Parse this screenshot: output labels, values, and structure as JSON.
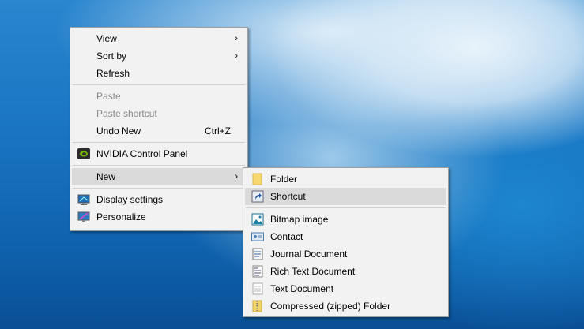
{
  "context_menu": {
    "items": [
      {
        "label": "View",
        "submenu": true
      },
      {
        "label": "Sort by",
        "submenu": true
      },
      {
        "label": "Refresh"
      },
      {
        "label": "Paste",
        "disabled": true
      },
      {
        "label": "Paste shortcut",
        "disabled": true
      },
      {
        "label": "Undo New",
        "shortcut": "Ctrl+Z"
      },
      {
        "label": "NVIDIA Control Panel",
        "icon": "nvidia-icon"
      },
      {
        "label": "New",
        "submenu": true,
        "highlighted": true
      },
      {
        "label": "Display settings",
        "icon": "display-icon"
      },
      {
        "label": "Personalize",
        "icon": "personalize-icon"
      }
    ],
    "arrow": "›"
  },
  "new_submenu": {
    "items": [
      {
        "label": "Folder",
        "icon": "folder-icon"
      },
      {
        "label": "Shortcut",
        "icon": "shortcut-icon",
        "highlighted": true
      },
      {
        "label": "Bitmap image",
        "icon": "bitmap-icon"
      },
      {
        "label": "Contact",
        "icon": "contact-icon"
      },
      {
        "label": "Journal Document",
        "icon": "journal-icon"
      },
      {
        "label": "Rich Text Document",
        "icon": "rtf-icon"
      },
      {
        "label": "Text Document",
        "icon": "text-document-icon"
      },
      {
        "label": "Compressed (zipped) Folder",
        "icon": "zip-folder-icon"
      }
    ]
  }
}
